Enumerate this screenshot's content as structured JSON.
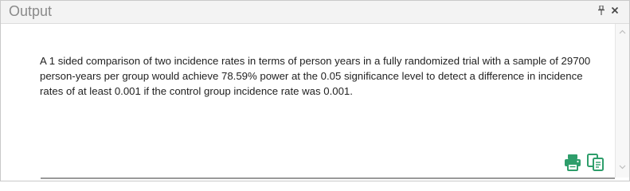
{
  "window": {
    "title": "Output",
    "pin_glyph": "†",
    "close_glyph": "×"
  },
  "output": {
    "text": "A 1 sided comparison of two incidence rates in terms of person years in a fully randomized trial with a sample of 29700 person-years per group would achieve 78.59% power at the 0.05 significance level to detect a difference in incidence rates of at least 0.001 if the control group incidence rate was 0.001."
  },
  "actions": {
    "print_icon": "printer-icon",
    "copy_icon": "copy-icon"
  },
  "colors": {
    "accent": "#2e9e6b",
    "title_text": "#8a8a8a",
    "body_text": "#222222"
  }
}
